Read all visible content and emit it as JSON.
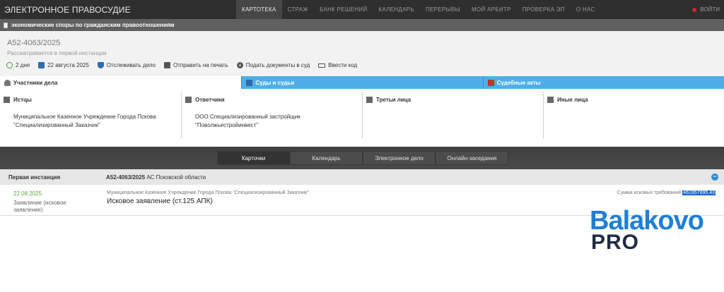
{
  "header": {
    "brand": "ЭЛЕКТРОННОЕ ПРАВОСУДИЕ",
    "nav": [
      "КАРТОТЕКА",
      "СТРАЖ",
      "БАНК РЕШЕНИЙ",
      "КАЛЕНДАРЬ",
      "ПЕРЕРЫВЫ",
      "МОЙ АРБИТР",
      "ПРОВЕРКА ЭП",
      "О НАС"
    ],
    "login": "ВОЙТИ",
    "accent": "#d6262b"
  },
  "category": "экономические споры по гражданским правоотношениям",
  "case": {
    "number": "А52-4063/2025",
    "stage": "Рассматривается в первой инстанции",
    "actions": [
      "2 дня",
      "22 августа 2025",
      "Отслеживать дело",
      "Отправить на печать",
      "Подать документы в суд",
      "Ввести код"
    ]
  },
  "tabs": [
    "Участники дела",
    "Суды и судьи",
    "Судебные акты"
  ],
  "participants": {
    "plaintiffs": {
      "label": "Истцы",
      "text": "Муниципальное Казенное Учреждение Города Пскова \"Специализированный Заказчик\""
    },
    "defendants": {
      "label": "Ответчики",
      "text": "ООО Специализированный застройщик \"Поволжьестройинвест\""
    },
    "third": {
      "label": "Третьи лица",
      "text": ""
    },
    "other": {
      "label": "Иные лица",
      "text": ""
    }
  },
  "subtabs": [
    "Карточки",
    "Календарь",
    "Электронное дело",
    "Онлайн-заседания"
  ],
  "instance": {
    "title": "Первая инстанция",
    "case_number": "А52-4063/2025",
    "court": "АС Псковской области",
    "entry": {
      "date": "22.08.2025",
      "type": "Заявление (исковое заявление)",
      "party": "Муниципальное Казенное Учреждение Города Пскова \"Специализированный Заказчик\"",
      "title": "Исковое заявление (ст.125 АПК)",
      "sum_label": "Сумма исковых требований",
      "sum_value": "461957695.43"
    }
  },
  "watermark": {
    "top": "Balakovo",
    "bottom": "PRO"
  }
}
